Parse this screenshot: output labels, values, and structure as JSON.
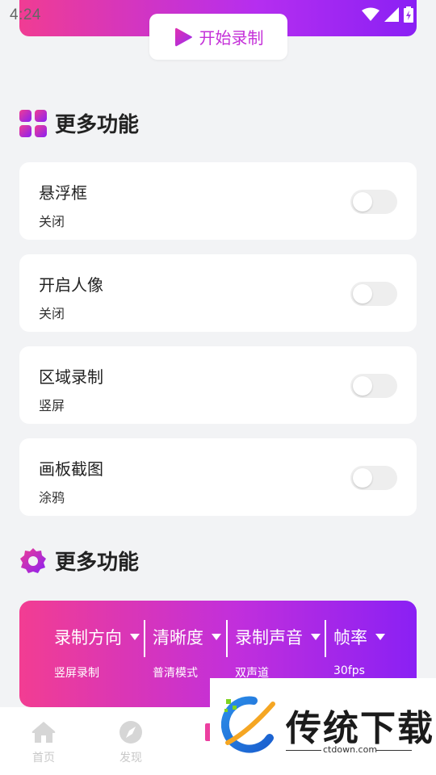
{
  "status_bar": {
    "time": "4:24"
  },
  "top_action": {
    "start_record_label": "开始录制"
  },
  "section1": {
    "title": "更多功能"
  },
  "features": [
    {
      "name": "悬浮框",
      "status": "关闭",
      "enabled": false
    },
    {
      "name": "开启人像",
      "status": "关闭",
      "enabled": false
    },
    {
      "name": "区域录制",
      "status": "竖屏",
      "enabled": false
    },
    {
      "name": "画板截图",
      "status": "涂鸦",
      "enabled": false
    }
  ],
  "section2": {
    "title": "更多功能"
  },
  "record_settings": [
    {
      "label": "录制方向",
      "value": "竖屏录制"
    },
    {
      "label": "清晰度",
      "value": "普清模式"
    },
    {
      "label": "录制声音",
      "value": "双声道"
    },
    {
      "label": "帧率",
      "value": "30fps"
    }
  ],
  "tabbar": {
    "items": [
      {
        "label": "首页"
      },
      {
        "label": "发现"
      }
    ]
  },
  "watermark": {
    "brand": "传统下载",
    "url": "ctdown.com"
  },
  "colors": {
    "accent_pink": "#f03c93",
    "accent_purple": "#8a20f4",
    "button_text": "#c42fd8"
  }
}
